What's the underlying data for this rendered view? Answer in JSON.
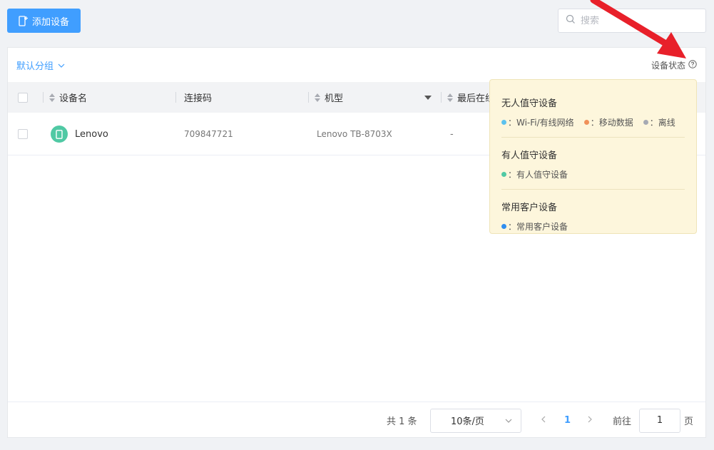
{
  "toolbar": {
    "add_label": "添加设备",
    "search_placeholder": "搜索"
  },
  "group_select": {
    "label": "默认分组"
  },
  "status_link": {
    "label": "设备状态"
  },
  "table": {
    "columns": [
      "设备名",
      "连接码",
      "机型",
      "最后在线"
    ],
    "rows": [
      {
        "name": "Lenovo",
        "code": "709847721",
        "model": "Lenovo TB-8703X",
        "last_online": "-"
      }
    ]
  },
  "popover": {
    "sections": [
      {
        "title": "无人值守设备",
        "items": [
          {
            "label": "：Wi-Fi/有线网络",
            "color": "#5cc2ee"
          },
          {
            "label": "：移动数据",
            "color": "#f0915a"
          },
          {
            "label": "：离线",
            "color": "#a6aab3"
          }
        ]
      },
      {
        "title": "有人值守设备",
        "items": [
          {
            "label": "：有人值守设备",
            "color": "#50c9a4"
          }
        ]
      },
      {
        "title": "常用客户设备",
        "items": [
          {
            "label": "：常用客户设备",
            "color": "#2f8ef0"
          }
        ]
      }
    ]
  },
  "pagination": {
    "total": "共 1 条",
    "page_size": "10条/页",
    "current_page": "1",
    "goto_label": "前往",
    "goto_value": "1",
    "page_unit": "页"
  },
  "colors": {
    "primary": "#409eff",
    "device": "#50c9a4",
    "annotation_arrow": "#e8202a"
  }
}
